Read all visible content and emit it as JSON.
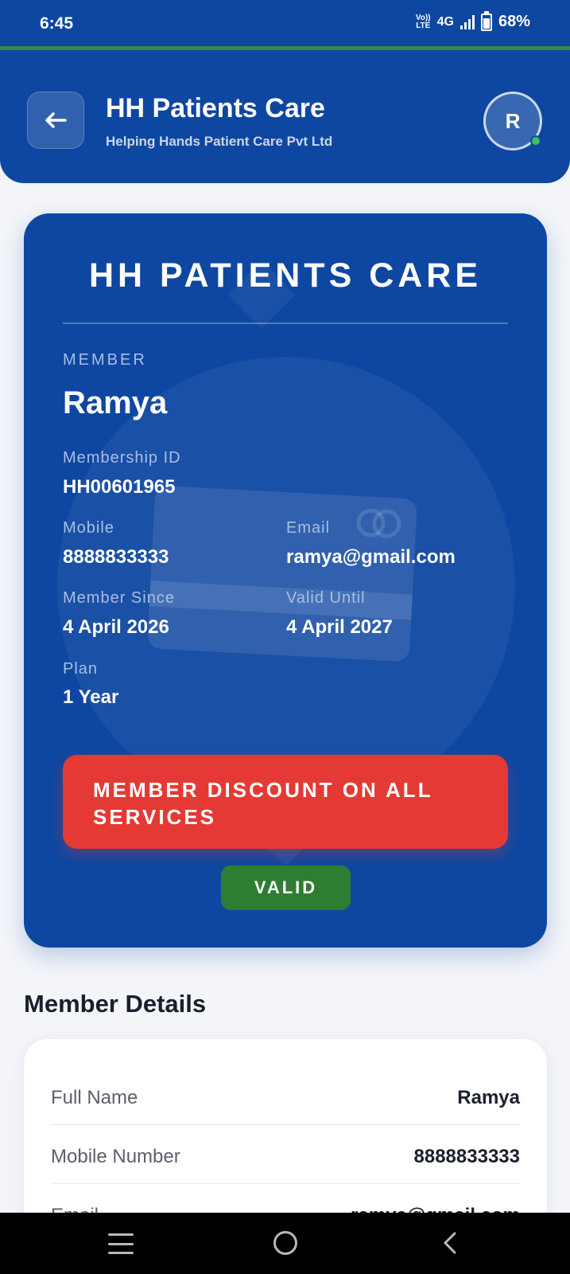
{
  "status_bar": {
    "time": "6:45",
    "volte_top": "Vo))",
    "volte_bottom": "LTE",
    "network": "4G",
    "battery": "68%"
  },
  "header": {
    "title": "HH Patients Care",
    "subtitle": "Helping Hands Patient Care Pvt Ltd",
    "avatar_initial": "R",
    "back_icon": "arrow-left-icon",
    "accent_color": "#0e47a1"
  },
  "membership_card": {
    "title": "HH PATIENTS CARE",
    "member_label": "MEMBER",
    "member_name": "Ramya",
    "membership_id_label": "Membership ID",
    "membership_id": "HH00601965",
    "mobile_label": "Mobile",
    "mobile": "8888833333",
    "email_label": "Email",
    "email": "ramya@gmail.com",
    "member_since_label": "Member Since",
    "member_since": "4 April 2026",
    "valid_until_label": "Valid Until",
    "valid_until": "4 April 2027",
    "plan_label": "Plan",
    "plan": "1 Year",
    "discount_text": "MEMBER DISCOUNT ON ALL SERVICES",
    "status_badge": "VALID",
    "discount_color": "#e53935",
    "valid_color": "#2e7d32"
  },
  "member_details": {
    "title": "Member Details",
    "rows": [
      {
        "label": "Full Name",
        "value": "Ramya"
      },
      {
        "label": "Mobile Number",
        "value": "8888833333"
      },
      {
        "label": "Email",
        "value": "ramya@gmail.com"
      }
    ]
  },
  "nav_bar": {
    "icons": [
      "menu-icon",
      "home-icon",
      "back-icon"
    ]
  }
}
